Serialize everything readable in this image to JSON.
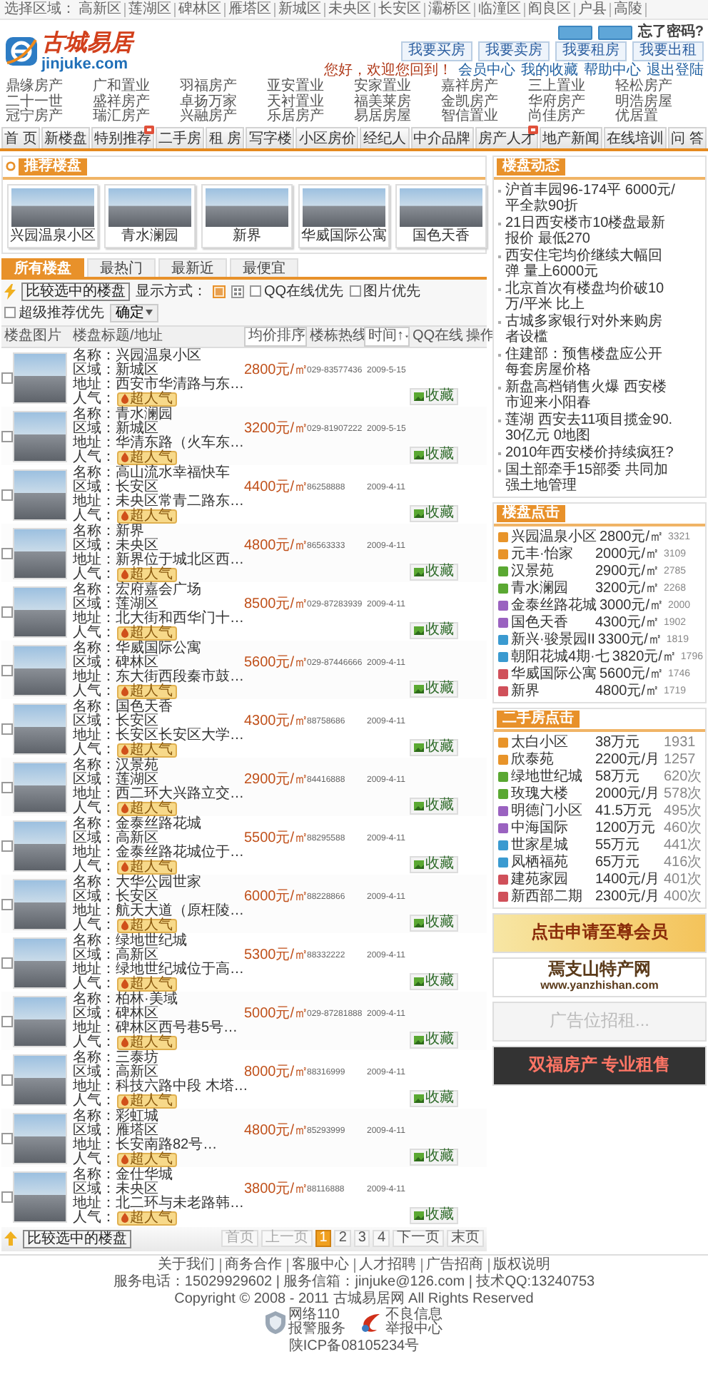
{
  "top_bar": {
    "label": "选择区域：",
    "regions": [
      "高新区",
      "莲湖区",
      "碑林区",
      "雁塔区",
      "新城区",
      "未央区",
      "长安区",
      "灞桥区",
      "临潼区",
      "阎良区",
      "户县",
      "高陵"
    ],
    "forgot": "忘了密码?"
  },
  "header": {
    "logo": {
      "title": "古城易居",
      "domain": "jinjuke.com"
    },
    "quick_buttons": [
      "我要买房",
      "我要卖房",
      "我要租房",
      "我要出租"
    ],
    "greeting": "您好，欢迎您回到！",
    "member_links": [
      "会员中心",
      "我的收藏",
      "帮助中心",
      "退出登陆"
    ],
    "agencies": [
      "鼎缘房产",
      "广和置业",
      "羽福房产",
      "亚安置业",
      "安家置业",
      "嘉祥房产",
      "三上置业",
      "轻松房产",
      "二十一世",
      "盛祥房产",
      "卓扬万家",
      "天衬置业",
      "福美莱房",
      "金凯房产",
      "华府房产",
      "明浩房屋",
      "冠宁房产",
      "瑞汇房产",
      "兴融房产",
      "乐居房产",
      "易居房屋",
      "智信置业",
      "尚佳房产",
      "优居置"
    ]
  },
  "nav": [
    {
      "label": "首 页",
      "badge": false
    },
    {
      "label": "新楼盘",
      "badge": false
    },
    {
      "label": "特别推荐",
      "badge": true
    },
    {
      "label": "二手房",
      "badge": false
    },
    {
      "label": "租 房",
      "badge": false
    },
    {
      "label": "写字楼",
      "badge": false
    },
    {
      "label": "小区房价",
      "badge": false
    },
    {
      "label": "经纪人",
      "badge": false
    },
    {
      "label": "中介品牌",
      "badge": false
    },
    {
      "label": "房产人才",
      "badge": true
    },
    {
      "label": "地产新闻",
      "badge": false
    },
    {
      "label": "在线培训",
      "badge": false
    },
    {
      "label": "问 答",
      "badge": false
    }
  ],
  "featured": {
    "title": "推荐楼盘",
    "items": [
      "兴园温泉小区",
      "青水澜园",
      "新界",
      "华威国际公寓",
      "国色天香"
    ]
  },
  "listing": {
    "tabs": [
      {
        "label": "所有楼盘",
        "selected": true
      },
      {
        "label": "最热门",
        "selected": false
      },
      {
        "label": "最新近",
        "selected": false
      },
      {
        "label": "最便宜",
        "selected": false
      }
    ],
    "toolbar": {
      "compare": "比较选中的楼盘",
      "display_label": "显示方式：",
      "views": [
        {
          "kind": "list",
          "selected": true
        },
        {
          "kind": "grid",
          "selected": false
        }
      ],
      "filters": [
        {
          "label": "QQ在线优先",
          "checked": false
        },
        {
          "label": "图片优先",
          "checked": false
        },
        {
          "label": "超级推荐优先",
          "checked": false
        }
      ],
      "confirm": "确定"
    },
    "columns": [
      {
        "label": "楼盘图片",
        "dropdown": false
      },
      {
        "label": "楼盘标题/地址",
        "dropdown": false
      },
      {
        "label": "均价排序",
        "dropdown": true
      },
      {
        "label": "楼栋热线",
        "dropdown": false
      },
      {
        "label": "时间↑",
        "dropdown": true
      },
      {
        "label": "QQ在线",
        "dropdown": false
      },
      {
        "label": "操作",
        "dropdown": false
      }
    ],
    "rows": [
      {
        "name": "名称：兴园温泉小区",
        "district": "区域：新城区",
        "address": "地址：西安市华清路与东…",
        "popularity_label": "人气：",
        "price": "2800元/㎡",
        "phone": "029-83577436",
        "date": "2009-5-15",
        "popularity": "超人气",
        "action": "收藏",
        "checked": false
      },
      {
        "name": "名称：青水澜园",
        "district": "区域：新城区",
        "address": "地址：华清东路（火车东…",
        "popularity_label": "人气：",
        "price": "3200元/㎡",
        "phone": "029-81907222",
        "date": "2009-5-15",
        "popularity": "超人气",
        "action": "收藏",
        "checked": false
      },
      {
        "name": "名称：高山流水幸福快车",
        "district": "区域：长安区",
        "address": "地址：未央区常青二路东…",
        "popularity_label": "人气：",
        "price": "4400元/㎡",
        "phone": "86258888",
        "date": "2009-4-11",
        "popularity": "超人气",
        "action": "收藏",
        "checked": false
      },
      {
        "name": "名称：新界",
        "district": "区域：未央区",
        "address": "地址：新界位于城北区西…",
        "popularity_label": "人气：",
        "price": "4800元/㎡",
        "phone": "86563333",
        "date": "2009-4-11",
        "popularity": "超人气",
        "action": "收藏",
        "checked": false
      },
      {
        "name": "名称：宏府嘉会广场",
        "district": "区域：莲湖区",
        "address": "地址：北大街和西华门十…",
        "popularity_label": "人气：",
        "price": "8500元/㎡",
        "phone": "029-87283939",
        "date": "2009-4-11",
        "popularity": "超人气",
        "action": "收藏",
        "checked": false
      },
      {
        "name": "名称：华威国际公寓",
        "district": "区域：碑林区",
        "address": "地址：东大街西段秦市鼓…",
        "popularity_label": "人气：",
        "price": "5600元/㎡",
        "phone": "029-87446666",
        "date": "2009-4-11",
        "popularity": "超人气",
        "action": "收藏",
        "checked": false
      },
      {
        "name": "名称：国色天香",
        "district": "区域：长安区",
        "address": "地址：长安区长安区大学…",
        "popularity_label": "人气：",
        "price": "4300元/㎡",
        "phone": "88758686",
        "date": "2009-4-11",
        "popularity": "超人气",
        "action": "收藏",
        "checked": false
      },
      {
        "name": "名称：汉景苑",
        "district": "区域：莲湖区",
        "address": "地址：西二环大兴路立交…",
        "popularity_label": "人气：",
        "price": "2900元/㎡",
        "phone": "84416888",
        "date": "2009-4-11",
        "popularity": "超人气",
        "action": "收藏",
        "checked": false
      },
      {
        "name": "名称：金泰丝路花城",
        "district": "区域：高新区",
        "address": "地址：金泰丝路花城位于…",
        "popularity_label": "人气：",
        "price": "5500元/㎡",
        "phone": "88295588",
        "date": "2009-4-11",
        "popularity": "超人气",
        "action": "收藏",
        "checked": false
      },
      {
        "name": "名称：大华公园世家",
        "district": "区域：长安区",
        "address": "地址：航天大道（原枉陵…",
        "popularity_label": "人气：",
        "price": "6000元/㎡",
        "phone": "88228866",
        "date": "2009-4-11",
        "popularity": "超人气",
        "action": "收藏",
        "checked": false
      },
      {
        "name": "名称：绿地世纪城",
        "district": "区域：高新区",
        "address": "地址：绿地世纪城位于高…",
        "popularity_label": "人气：",
        "price": "5300元/㎡",
        "phone": "88332222",
        "date": "2009-4-11",
        "popularity": "超人气",
        "action": "收藏",
        "checked": false
      },
      {
        "name": "名称：柏林·美域",
        "district": "区域：碑林区",
        "address": "地址：碑林区西号巷5号…",
        "popularity_label": "人气：",
        "price": "5000元/㎡",
        "phone": "029-87281888",
        "date": "2009-4-11",
        "popularity": "超人气",
        "action": "收藏",
        "checked": false
      },
      {
        "name": "名称：三泰坊",
        "district": "区域：高新区",
        "address": "地址：科技六路中段 木塔…",
        "popularity_label": "人气：",
        "price": "8000元/㎡",
        "phone": "88316999",
        "date": "2009-4-11",
        "popularity": "超人气",
        "action": "收藏",
        "checked": false
      },
      {
        "name": "名称：彩虹城",
        "district": "区域：雁塔区",
        "address": "地址：长安南路82号…",
        "popularity_label": "人气：",
        "price": "4800元/㎡",
        "phone": "85293999",
        "date": "2009-4-11",
        "popularity": "超人气",
        "action": "收藏",
        "checked": false
      },
      {
        "name": "名称：金仕华城",
        "district": "区域：未央区",
        "address": "地址：北二环与未老路韩…",
        "popularity_label": "人气：",
        "price": "3800元/㎡",
        "phone": "88116888",
        "date": "2009-4-11",
        "popularity": "超人气",
        "action": "收藏",
        "checked": false
      }
    ],
    "bottom": {
      "compare": "比较选中的楼盘",
      "pager": [
        {
          "label": "首页",
          "selected": false,
          "disabled": true
        },
        {
          "label": "上一页",
          "selected": false,
          "disabled": true
        },
        {
          "label": "1",
          "selected": true,
          "disabled": false
        },
        {
          "label": "2",
          "selected": false,
          "disabled": false
        },
        {
          "label": "3",
          "selected": false,
          "disabled": false
        },
        {
          "label": "4",
          "selected": false,
          "disabled": false
        },
        {
          "label": "下一页",
          "selected": false,
          "disabled": false
        },
        {
          "label": "末页",
          "selected": false,
          "disabled": false
        }
      ]
    }
  },
  "sidebar": {
    "news": {
      "title": "楼盘动态",
      "items": [
        "沪首丰园96-174平 6000元/平全款90折",
        "21日西安楼市10楼盘最新报价 最低270",
        "西安住宅均价继续大幅回弹 量上6000元",
        "北京首次有楼盘均价破10万/平米 比上",
        "古城多家银行对外来购房者设槛",
        "住建部：预售楼盘应公开每套房屋价格",
        "新盘高档销售火爆 西安楼市迎来小阳春",
        "莲湖 西安去11项目揽金90.30亿元 0地图",
        "2010年西安楼价持续疯狂?",
        "国土部牵手15部委 共同加强土地管理"
      ]
    },
    "hot": {
      "title": "楼盘点击",
      "items": [
        {
          "name": "兴园温泉小区",
          "price": "2800元/㎡",
          "count": "3321",
          "color": "#e8942a"
        },
        {
          "name": "元丰·怡家",
          "price": "2000元/㎡",
          "count": "3109",
          "color": "#e8942a"
        },
        {
          "name": "汉景苑",
          "price": "2900元/㎡",
          "count": "2785",
          "color": "#5aa832"
        },
        {
          "name": "青水澜园",
          "price": "3200元/㎡",
          "count": "2268",
          "color": "#5aa832"
        },
        {
          "name": "金泰丝路花城",
          "price": "3000元/㎡",
          "count": "2000",
          "color": "#9a62c0"
        },
        {
          "name": "国色天香",
          "price": "4300元/㎡",
          "count": "1902",
          "color": "#9a62c0"
        },
        {
          "name": "新兴·骏景园II",
          "price": "3300元/㎡",
          "count": "1819",
          "color": "#3a9ad0"
        },
        {
          "name": "朝阳花城4期·七",
          "price": "3820元/㎡",
          "count": "1796",
          "color": "#3a9ad0"
        },
        {
          "name": "华威国际公寓",
          "price": "5600元/㎡",
          "count": "1746",
          "color": "#d0505a"
        },
        {
          "name": "新界",
          "price": "4800元/㎡",
          "count": "1719",
          "color": "#d0505a"
        }
      ]
    },
    "second_hand": {
      "title": "二手房点击",
      "items": [
        {
          "name": "太白小区",
          "price": "38万元",
          "count": "1931",
          "color": "#e8942a"
        },
        {
          "name": "欣泰苑",
          "price": "2200元/月",
          "count": "1257",
          "color": "#e8942a"
        },
        {
          "name": "绿地世纪城",
          "price": "58万元",
          "count": "620次",
          "color": "#5aa832"
        },
        {
          "name": "玫瑰大楼",
          "price": "2000元/月",
          "count": "578次",
          "color": "#5aa832"
        },
        {
          "name": "明德门小区",
          "price": "41.5万元",
          "count": "495次",
          "color": "#9a62c0"
        },
        {
          "name": "中海国际",
          "price": "1200万元",
          "count": "460次",
          "color": "#9a62c0"
        },
        {
          "name": "世家星城",
          "price": "55万元",
          "count": "441次",
          "color": "#3a9ad0"
        },
        {
          "name": "凤栖福苑",
          "price": "65万元",
          "count": "416次",
          "color": "#3a9ad0"
        },
        {
          "name": "建苑家园",
          "price": "1400元/月",
          "count": "401次",
          "color": "#d0505a"
        },
        {
          "name": "新西部二期",
          "price": "2300元/月",
          "count": "400次",
          "color": "#d0505a"
        }
      ]
    },
    "ads": [
      {
        "kind": "member",
        "lines": [
          "点击申请至尊会员"
        ]
      },
      {
        "kind": "shop",
        "lines": [
          "焉支山特产网",
          "www.yanzhishan.com"
        ]
      },
      {
        "kind": "vacant",
        "lines": [
          "广告位招租..."
        ]
      },
      {
        "kind": "agency",
        "lines": [
          "双福房产 专业租售"
        ]
      }
    ]
  },
  "footer": {
    "links": [
      "关于我们",
      "商务合作",
      "客服中心",
      "人才招聘",
      "广告招商",
      "版权说明"
    ],
    "contact": "服务电话：15029929602 | 服务信箱：jinjuke@126.com | 技术QQ:13240753",
    "copyright": "Copyright © 2008 - 2011 古城易居网 All Rights Reserved",
    "badges": [
      {
        "kind": "police",
        "lines": [
          "网络110",
          "报警服务"
        ]
      },
      {
        "kind": "report",
        "lines": [
          "不良信息",
          "举报中心"
        ]
      }
    ],
    "icp": "陕ICP备08105234号"
  }
}
